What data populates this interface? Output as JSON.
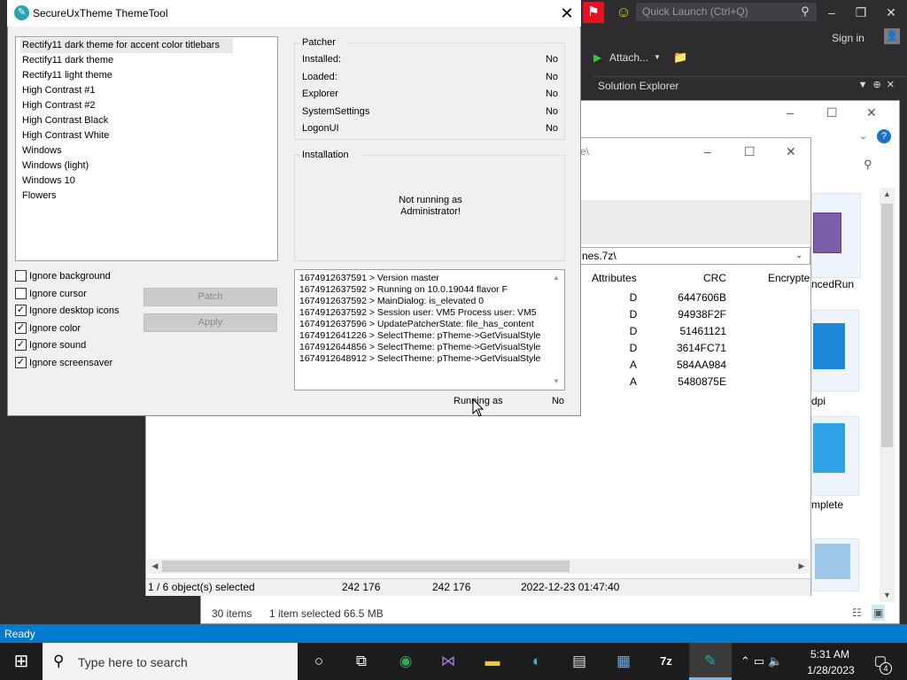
{
  "theme_tool": {
    "title": "SecureUxTheme ThemeTool",
    "icon": "themetool-app-icon",
    "close_glyph": "✕",
    "themes": [
      "Rectify11 dark theme for accent color titlebars",
      "Rectify11 dark theme",
      "Rectify11 light theme",
      "High Contrast #1",
      "High Contrast #2",
      "High Contrast Black",
      "High Contrast White",
      "Windows",
      "Windows (light)",
      "Windows 10",
      "Flowers"
    ],
    "selected_theme": "Rectify11 dark theme for accent color titlebars",
    "options": [
      {
        "label": "Ignore background",
        "checked": false
      },
      {
        "label": "Ignore cursor",
        "checked": false
      },
      {
        "label": "Ignore desktop icons",
        "checked": true
      },
      {
        "label": "Ignore color",
        "checked": true
      },
      {
        "label": "Ignore sound",
        "checked": true
      },
      {
        "label": "Ignore screensaver",
        "checked": true
      }
    ],
    "buttons": {
      "patch": "Patch",
      "apply": "Apply"
    },
    "patcher": {
      "title": "Patcher",
      "rows": [
        {
          "label": "Installed:",
          "value": "No"
        },
        {
          "label": "Loaded:",
          "value": "No"
        },
        {
          "label": "Explorer",
          "value": "No"
        },
        {
          "label": "SystemSettings",
          "value": "No"
        },
        {
          "label": "LogonUI",
          "value": "No"
        }
      ]
    },
    "installation": {
      "title": "Installation",
      "message_line1": "Not running as",
      "message_line2": "Administrator!"
    },
    "log": [
      "1674912637591 > Version master",
      "1674912637592 > Running on 10.0.19044 flavor F",
      "1674912637592 > MainDialog: is_elevated 0",
      "1674912637592 > Session user: VM5 Process user: VM5",
      "1674912637596 > UpdatePatcherState: file_has_content",
      "1674912641226 > SelectTheme: pTheme->GetVisualStyle",
      "1674912644856 > SelectTheme: pTheme->GetVisualStyle",
      "1674912648912 > SelectTheme: pTheme->GetVisualStyle"
    ],
    "running_as_label": "Running as",
    "running_as_value": "No"
  },
  "visual_studio": {
    "quick_launch_placeholder": "Quick Launch (Ctrl+Q)",
    "sign_in": "Sign in",
    "attach": "Attach...",
    "solution_explorer": "Solution Explorer",
    "status": "Ready"
  },
  "explorer": {
    "tiles": [
      "ncedRun",
      "dpi",
      "mplete"
    ],
    "status_count": "30 items",
    "status_selected": "1 item selected  66.5 MB"
  },
  "sevenzip": {
    "path_fragment": "e\\",
    "address": "nes.7z\\",
    "columns": [
      "Attributes",
      "CRC",
      "Encrypte"
    ],
    "rows": [
      {
        "attr": "D",
        "crc": "6447606B"
      },
      {
        "attr": "D",
        "crc": "94938F2F"
      },
      {
        "attr": "D",
        "crc": "51461121"
      },
      {
        "attr": "D",
        "crc": "3614FC71"
      },
      {
        "attr": "A",
        "crc": "584AA984"
      },
      {
        "attr": "A",
        "crc": "5480875E"
      }
    ],
    "status": {
      "selected": "1 / 6 object(s) selected",
      "size1": "242 176",
      "size2": "242 176",
      "modified": "2022-12-23 01:47:40"
    }
  },
  "taskbar": {
    "search_placeholder": "Type here to search",
    "time": "5:31 AM",
    "date": "1/28/2023",
    "notification_count": "4",
    "apps": [
      "cortana-icon",
      "task-view-icon",
      "chrome-icon",
      "visual-studio-icon",
      "file-explorer-icon",
      "edge-icon",
      "notepad-icon",
      "store-icon",
      "7zip-icon",
      "themetool-icon"
    ]
  }
}
